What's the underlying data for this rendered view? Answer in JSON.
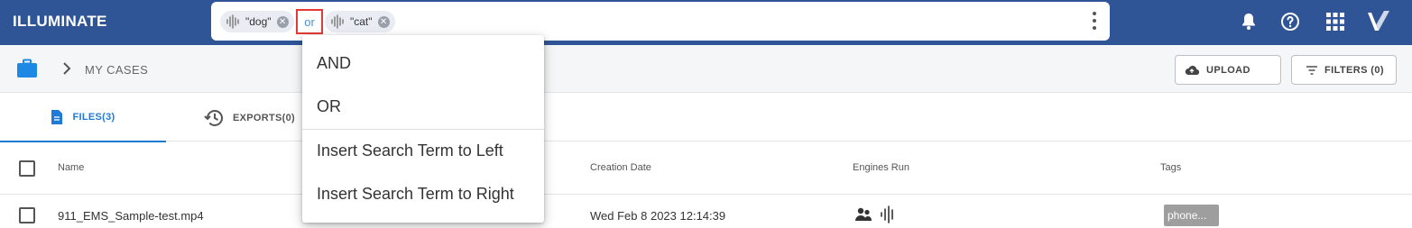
{
  "app": {
    "brand": "ILLUMINATE"
  },
  "search": {
    "chips": [
      {
        "label": "\"dog\""
      },
      {
        "label": "\"cat\""
      }
    ],
    "operator": "or",
    "clear_glyph": "✕"
  },
  "operator_menu": {
    "items": [
      {
        "label": "AND"
      },
      {
        "label": "OR"
      },
      {
        "label": "Insert Search Term to Left"
      },
      {
        "label": "Insert Search Term to Right"
      }
    ]
  },
  "breadcrumb": {
    "label": "MY CASES"
  },
  "toolbar": {
    "upload_label": "UPLOAD",
    "filters_label": "FILTERS (0)"
  },
  "tabs": [
    {
      "label": "FILES(3)",
      "active": true
    },
    {
      "label": "EXPORTS(0)",
      "active": false
    }
  ],
  "table": {
    "columns": [
      "Name",
      "Creation Date",
      "Engines Run",
      "Tags"
    ],
    "rows": [
      {
        "name": "911_EMS_Sample-test.mp4",
        "creation_date": "Wed Feb 8 2023 12:14:39",
        "engines": [
          "people-icon",
          "audio-waveform-icon"
        ],
        "tag": "phone..."
      }
    ]
  },
  "colors": {
    "topbar": "#2f5597",
    "accent": "#1f7ad6",
    "highlight_border": "#e53935"
  }
}
